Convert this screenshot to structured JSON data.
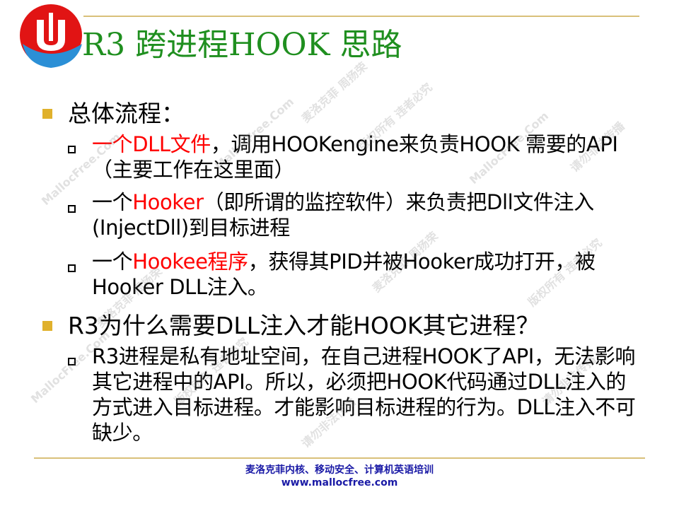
{
  "title": "R3 跨进程HOOK 思路",
  "watermarks": [
    "MallocFree.Com",
    "麦洛克菲 周扬荣",
    "版权所有 违者必究",
    "请勿非法传播"
  ],
  "sections": [
    {
      "heading": "总体流程：",
      "items": [
        {
          "red": "一个DLL文件",
          "rest": "，调用HOOKengine来负责HOOK 需要的API（主要工作在这里面）"
        },
        {
          "prefix": "一个",
          "red": "Hooker",
          "rest": "（即所谓的监控软件）来负责把Dll文件注入(InjectDll)到目标进程"
        },
        {
          "prefix": "一个",
          "red": "Hookee程序",
          "rest": "，获得其PID并被Hooker成功打开，被Hooker DLL注入。"
        }
      ]
    },
    {
      "heading": "R3为什么需要DLL注入才能HOOK其它进程？",
      "items": [
        {
          "rest": "R3进程是私有地址空间，在自己进程HOOK了API，无法影响其它进程中的API。所以，必须把HOOK代码通过DLL注入的方式进入目标进程。才能影响目标进程的行为。DLL注入不可缺少。"
        }
      ]
    }
  ],
  "footer": {
    "line1": "麦洛克菲内核、移动安全、计算机英语培训",
    "line2": "www.mallocfree.com"
  },
  "colors": {
    "title": "#1f8f1f",
    "accent": "#ff0000",
    "bullet": "#e0b12c",
    "footer": "#1a1aa6"
  }
}
